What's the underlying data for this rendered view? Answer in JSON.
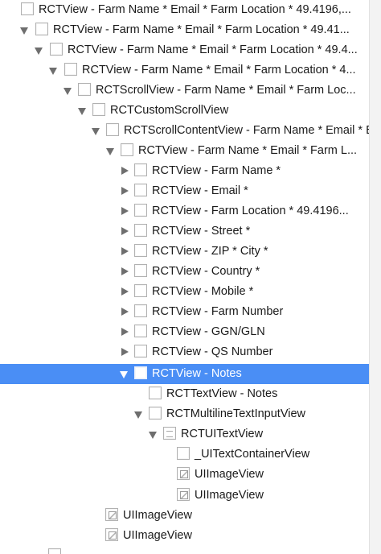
{
  "hierarchy": [
    {
      "label": "RCTView - Farm Name * Email * Farm Location * 49.4196,...",
      "disclosure": "none",
      "icon": "view"
    },
    {
      "label": "RCTView - Farm Name * Email * Farm Location * 49.41...",
      "disclosure": "open",
      "icon": "view"
    },
    {
      "label": "RCTView - Farm Name * Email * Farm Location * 49.4...",
      "disclosure": "open",
      "icon": "view"
    },
    {
      "label": "RCTView - Farm Name * Email * Farm Location * 4...",
      "disclosure": "open",
      "icon": "view"
    },
    {
      "label": "RCTScrollView - Farm Name * Email * Farm Loc...",
      "disclosure": "open",
      "icon": "view"
    },
    {
      "label": "RCTCustomScrollView",
      "disclosure": "open",
      "icon": "view"
    },
    {
      "label": "RCTScrollContentView - Farm Name * Email * Em...",
      "disclosure": "open",
      "icon": "view"
    },
    {
      "label": "RCTView - Farm Name * Email * Farm L...",
      "disclosure": "open",
      "icon": "view"
    },
    {
      "label": "RCTView - Farm Name *",
      "disclosure": "closed",
      "icon": "view"
    },
    {
      "label": "RCTView - Email *",
      "disclosure": "closed",
      "icon": "view"
    },
    {
      "label": "RCTView - Farm Location * 49.4196...",
      "disclosure": "closed",
      "icon": "view"
    },
    {
      "label": "RCTView - Street *",
      "disclosure": "closed",
      "icon": "view"
    },
    {
      "label": "RCTView - ZIP * City *",
      "disclosure": "closed",
      "icon": "view"
    },
    {
      "label": "RCTView - Country *",
      "disclosure": "closed",
      "icon": "view"
    },
    {
      "label": "RCTView - Mobile *",
      "disclosure": "closed",
      "icon": "view"
    },
    {
      "label": "RCTView - Farm Number",
      "disclosure": "closed",
      "icon": "view"
    },
    {
      "label": "RCTView - GGN/GLN",
      "disclosure": "closed",
      "icon": "view"
    },
    {
      "label": "RCTView - QS Number",
      "disclosure": "closed",
      "icon": "view"
    },
    {
      "label": "RCTView - Notes",
      "disclosure": "open",
      "icon": "view",
      "selected": true
    },
    {
      "label": "RCTTextView - Notes",
      "disclosure": "none",
      "icon": "view"
    },
    {
      "label": "RCTMultilineTextInputView",
      "disclosure": "open",
      "icon": "view"
    },
    {
      "label": "RCTUITextView",
      "disclosure": "open",
      "icon": "textview"
    },
    {
      "label": "_UITextContainerView",
      "disclosure": "none",
      "icon": "view"
    },
    {
      "label": "UIImageView",
      "disclosure": "none",
      "icon": "image"
    },
    {
      "label": "UIImageView",
      "disclosure": "none",
      "icon": "image"
    },
    {
      "label": "UIImageView",
      "disclosure": "none",
      "icon": "image"
    },
    {
      "label": "UIImageView",
      "disclosure": "none",
      "icon": "image"
    },
    {
      "label": "",
      "disclosure": "none",
      "icon": "view"
    }
  ]
}
